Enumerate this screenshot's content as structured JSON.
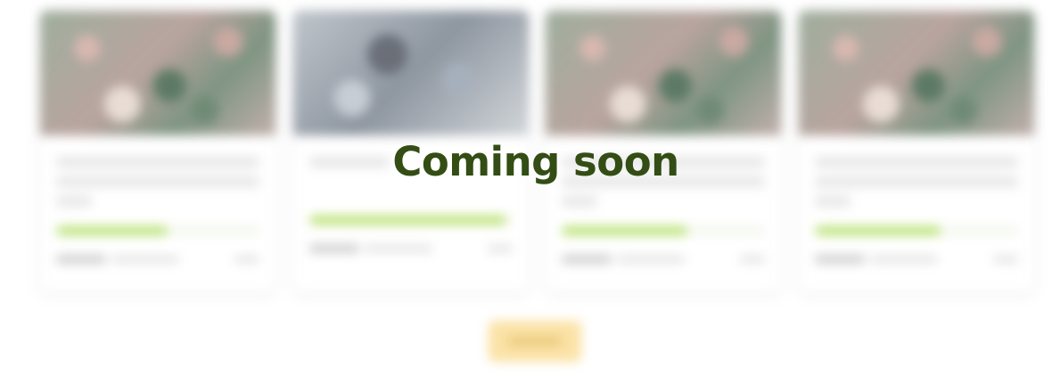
{
  "overlay": {
    "title": "Coming soon",
    "title_color": "#334d14"
  },
  "cards": [
    {
      "progress": 0.55,
      "thumb": "photo-collage"
    },
    {
      "progress": 0.97,
      "thumb": "photo-grey"
    },
    {
      "progress": 0.62,
      "thumb": "photo-collage"
    },
    {
      "progress": 0.62,
      "thumb": "photo-collage"
    }
  ],
  "colors": {
    "progress_fill": "#b7e070",
    "load_more_bg": "#fbe2a6"
  }
}
